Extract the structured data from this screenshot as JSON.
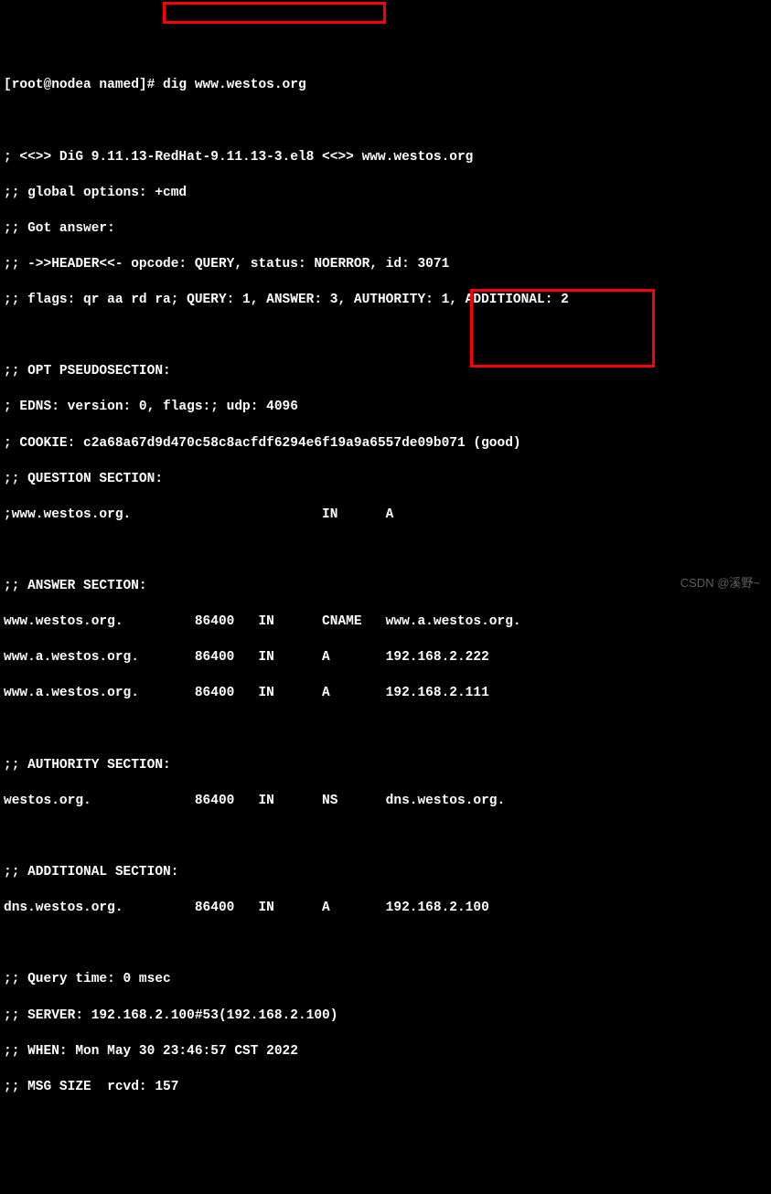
{
  "prompt": {
    "user_host": "[root@nodea named]# ",
    "command": "dig www.westos.org"
  },
  "header": {
    "version_line": "; <<>> DiG 9.11.13-RedHat-9.11.13-3.el8 <<>> www.westos.org",
    "global_options": ";; global options: +cmd",
    "got_answer": ";; Got answer:",
    "header_line": ";; ->>HEADER<<- opcode: QUERY, status: NOERROR, id: 3071",
    "flags_line": ";; flags: qr aa rd ra; QUERY: 1, ANSWER: 3, AUTHORITY: 1, ADDITIONAL: 2"
  },
  "opt_section": {
    "title": ";; OPT PSEUDOSECTION:",
    "edns": "; EDNS: version: 0, flags:; udp: 4096",
    "cookie": "; COOKIE: c2a68a67d9d470c58c8acfdf6294e6f19a9a6557de09b071 (good)"
  },
  "question_section": {
    "title": ";; QUESTION SECTION:",
    "row": ";www.westos.org.                        IN      A"
  },
  "answer_section": {
    "title": ";; ANSWER SECTION:",
    "rows": [
      "www.westos.org.         86400   IN      CNAME   www.a.westos.org.",
      "www.a.westos.org.       86400   IN      A       192.168.2.222",
      "www.a.westos.org.       86400   IN      A       192.168.2.111"
    ]
  },
  "authority_section": {
    "title": ";; AUTHORITY SECTION:",
    "row": "westos.org.             86400   IN      NS      dns.westos.org."
  },
  "additional_section": {
    "title": ";; ADDITIONAL SECTION:",
    "row": "dns.westos.org.         86400   IN      A       192.168.2.100"
  },
  "footer": {
    "query_time": ";; Query time: 0 msec",
    "server": ";; SERVER: 192.168.2.100#53(192.168.2.100)",
    "when": ";; WHEN: Mon May 30 23:46:57 CST 2022",
    "msg_size": ";; MSG SIZE  rcvd: 157"
  },
  "watermark": "CSDN @溪野~",
  "watermark2": ""
}
